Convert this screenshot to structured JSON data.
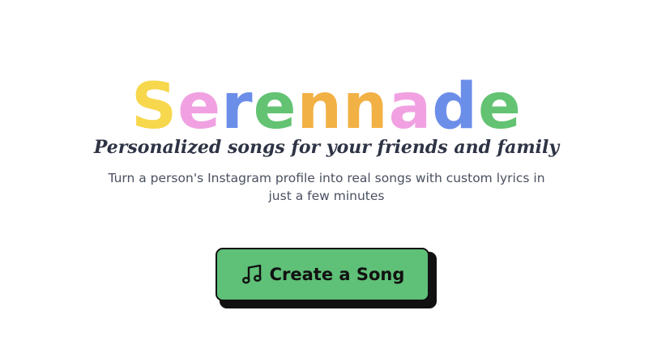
{
  "logo": {
    "letters": [
      "S",
      "e",
      "r",
      "e",
      "n",
      "n",
      "a",
      "d",
      "e"
    ],
    "colors": [
      "#f7d74c",
      "#f1a1e1",
      "#6b8ee9",
      "#63c372",
      "#f2b145",
      "#f2b145",
      "#f1a1e1",
      "#6b8ee9",
      "#63c372"
    ]
  },
  "hero": {
    "tagline": "Personalized songs for your friends and family",
    "description": "Turn a person's Instagram profile into real songs with custom lyrics in just a few minutes"
  },
  "cta": {
    "label": "Create a Song",
    "icon": "music-note-icon",
    "background": "#5fc078"
  }
}
